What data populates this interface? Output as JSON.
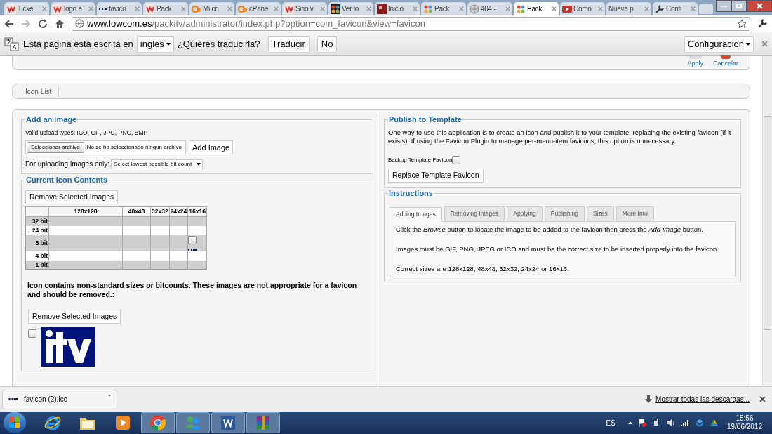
{
  "browser": {
    "tabs": [
      {
        "title": "Ticke",
        "kind": "w",
        "selected": false
      },
      {
        "title": "logo e",
        "kind": "w",
        "selected": false
      },
      {
        "title": "favico",
        "kind": "dots",
        "selected": false
      },
      {
        "title": "Pack",
        "kind": "w",
        "selected": false
      },
      {
        "title": "Mi cn",
        "kind": "cp",
        "selected": false
      },
      {
        "title": "cPane",
        "kind": "cp",
        "selected": false
      },
      {
        "title": "Sitio v",
        "kind": "w",
        "selected": false
      },
      {
        "title": "Ver lo",
        "kind": "joomla-dark",
        "selected": false
      },
      {
        "title": "Inicio",
        "kind": "r4",
        "selected": false
      },
      {
        "title": "Pack",
        "kind": "joomla",
        "selected": false
      },
      {
        "title": "404 -",
        "kind": "globe",
        "selected": false
      },
      {
        "title": "Pack",
        "kind": "joomla",
        "selected": true
      },
      {
        "title": "Como",
        "kind": "video",
        "selected": false
      },
      {
        "title": "Nueva p",
        "kind": "plain",
        "selected": false
      },
      {
        "title": "Confi",
        "kind": "wrench",
        "selected": false
      }
    ],
    "address": {
      "host": "www.lowcom.es",
      "path": "/packitv/administrator/index.php?option=com_favicon&view=favicon"
    }
  },
  "translate_bar": {
    "message": "Esta página está escrita en",
    "language": "inglés",
    "question": "¿Quieres traducirla?",
    "buttons": [
      "Traducir",
      "No"
    ],
    "settings": "Configuración"
  },
  "toolbar": [
    {
      "label": "Apply",
      "kind": "apply"
    },
    {
      "label": "Cancelar",
      "kind": "cancel"
    }
  ],
  "submenu": [
    "Icon List"
  ],
  "add_image": {
    "title": "Add an image",
    "hint": "Valid upload types: ICO, GIF, JPG, PNG, BMP",
    "file_button": "Seleccionar archivo",
    "file_status": "No se ha seleccionado ningun archivo",
    "add_button": "Add Image",
    "bit_label": "For uploading images only:",
    "bit_select": "Select lowest possible bit count"
  },
  "icon_contents": {
    "title": "Current Icon Contents",
    "remove_button": "Remove Selected Images",
    "columns": [
      "128x128",
      "48x48",
      "32x32",
      "24x24",
      "16x16"
    ],
    "rows": [
      {
        "label": "32 bit",
        "cells": [
          {
            "image": false
          },
          {
            "image": false
          },
          {
            "image": false
          },
          {
            "image": false
          },
          {
            "image": false
          }
        ]
      },
      {
        "label": "24 bit",
        "cells": [
          {
            "image": false
          },
          {
            "image": false
          },
          {
            "image": false
          },
          {
            "image": false
          },
          {
            "image": false
          }
        ]
      },
      {
        "label": "8 bit",
        "cells": [
          {
            "image": false
          },
          {
            "image": false
          },
          {
            "image": false
          },
          {
            "image": false
          },
          {
            "image": true,
            "checked": false
          }
        ]
      },
      {
        "label": "4 bit",
        "cells": [
          {
            "image": false
          },
          {
            "image": false
          },
          {
            "image": false
          },
          {
            "image": false
          },
          {
            "image": false
          }
        ]
      },
      {
        "label": "1 bit",
        "cells": [
          {
            "image": false
          },
          {
            "image": false
          },
          {
            "image": false
          },
          {
            "image": false
          },
          {
            "image": false
          }
        ]
      }
    ],
    "warning": "Icon contains non-standard sizes or bitcounts. These images are not appropriate for a favicon and should be removed.:",
    "remove_button_2": "Remove Selected Images",
    "images": [
      {
        "kind": "picture",
        "checked": false
      }
    ]
  },
  "publish": {
    "title": "Publish to Template",
    "description": "One way to use this application is to create an icon and publish it to your template, replacing the existing favicon (if it exists). If using the Favicon Plugin to manage per-menu-item favicons, this option is unnecessary.",
    "backup_label": "Backup Template Favicon",
    "backup_checked": false,
    "button": "Replace Template Favicon"
  },
  "instructions": {
    "title": "Instructions",
    "tabs": [
      {
        "label": "Adding Images",
        "selected": true
      },
      {
        "label": "Removing Images",
        "selected": false
      },
      {
        "label": "Applying",
        "selected": false
      },
      {
        "label": "Publishing",
        "selected": false
      },
      {
        "label": "Sizes",
        "selected": false
      },
      {
        "label": "More Info",
        "selected": false
      }
    ],
    "paragraphs": [
      "Click the *Browse* button to locate the image to be added to the favicon then press the *Add Image* button.",
      "Images must be GIF, PNG, JPEG or ICO and must be the correct size to be inserted properly into the favicon.",
      "Correct sizes are 128x128, 48x48, 32x32, 24x24 or 16x16."
    ]
  },
  "download_bar": {
    "file": "favicon (2).ico",
    "show_all": "Mostrar todas las descargas..."
  },
  "taskbar": {
    "apps": [
      {
        "kind": "ie",
        "running": false
      },
      {
        "kind": "folder",
        "running": false
      },
      {
        "kind": "media",
        "running": false
      },
      {
        "kind": "chrome",
        "running": true
      },
      {
        "kind": "messenger",
        "running": true
      },
      {
        "kind": "word",
        "running": true
      },
      {
        "kind": "archive",
        "running": true
      }
    ],
    "tray": {
      "language": "ES",
      "time": "15:56",
      "date": "19/06/2012"
    }
  }
}
